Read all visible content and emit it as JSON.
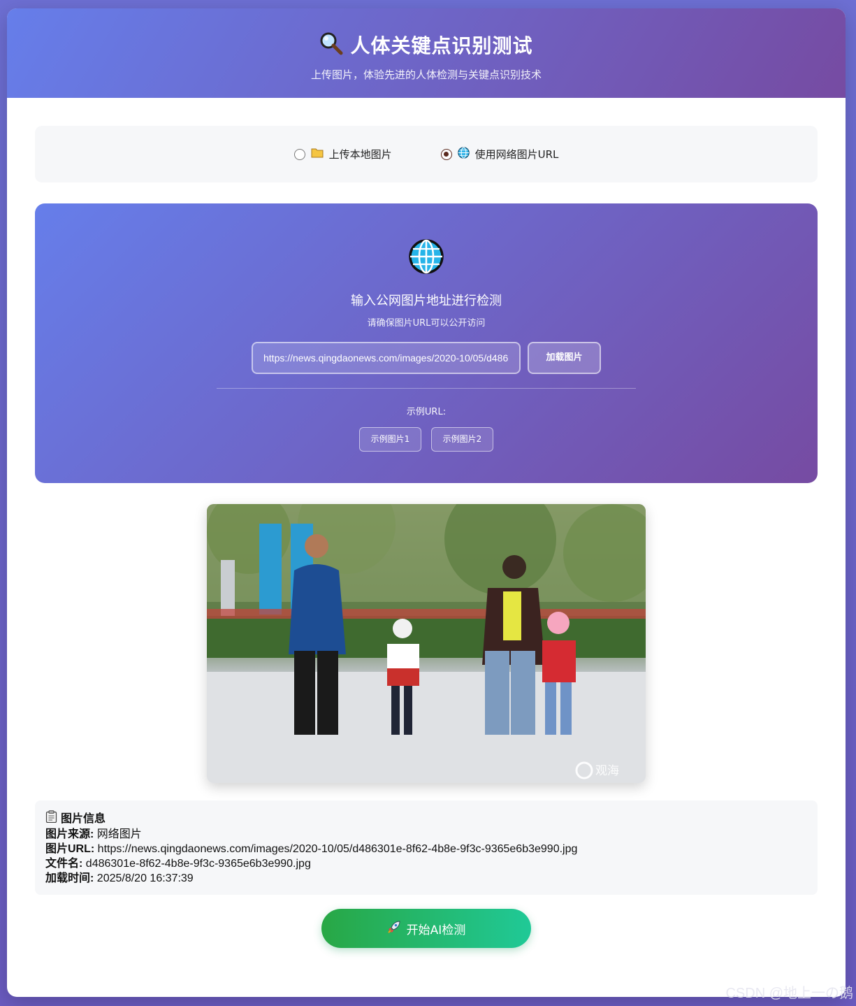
{
  "header": {
    "icon": "magnifier-icon",
    "title": "人体关键点识别测试",
    "subtitle": "上传图片，体验先进的人体检测与关键点识别技术"
  },
  "mode": {
    "options": [
      {
        "icon": "folder-icon",
        "label": "上传本地图片",
        "checked": false
      },
      {
        "icon": "globe-icon",
        "label": "使用网络图片URL",
        "checked": true
      }
    ]
  },
  "url_panel": {
    "icon": "globe-icon",
    "title": "输入公网图片地址进行检测",
    "hint": "请确保图片URL可以公开访问",
    "input_value": "https://news.qingdaonews.com/images/2020-10/05/d486",
    "load_button": "加载图片",
    "examples_label": "示例URL:",
    "examples": [
      "示例图片1",
      "示例图片2"
    ]
  },
  "preview": {
    "watermark": "观海"
  },
  "image_info": {
    "icon": "clipboard-icon",
    "title": "图片信息",
    "source_label": "图片来源:",
    "source_value": "网络图片",
    "url_label": "图片URL:",
    "url_value": "https://news.qingdaonews.com/images/2020-10/05/d486301e-8f62-4b8e-9f3c-9365e6b3e990.jpg",
    "filename_label": "文件名:",
    "filename_value": "d486301e-8f62-4b8e-9f3c-9365e6b3e990.jpg",
    "time_label": "加载时间:",
    "time_value": "2025/8/20 16:37:39"
  },
  "start_button": {
    "icon": "rocket-icon",
    "label": "开始AI检测"
  },
  "watermark": "CSDN @地上一の鹅",
  "colors": {
    "header_gradient_start": "#667eea",
    "header_gradient_end": "#764ba2",
    "start_button_start": "#28a745",
    "start_button_end": "#20c997"
  }
}
